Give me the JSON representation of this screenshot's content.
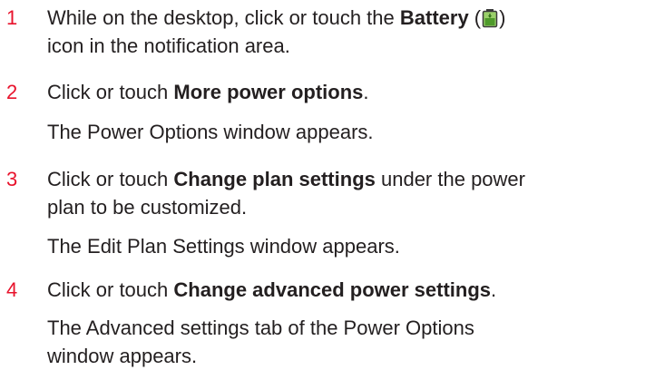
{
  "steps": [
    {
      "number": "1",
      "line1_pre": "While on the desktop, click or touch the ",
      "line1_bold": "Battery",
      "line1_paren_open": " (",
      "icon": "battery-icon",
      "line1_paren_close": ")",
      "line2": "icon in the notification area."
    },
    {
      "number": "2",
      "pre": "Click or touch ",
      "bold": "More power options",
      "post": ".",
      "result": "The Power Options window appears."
    },
    {
      "number": "3",
      "pre": "Click or touch ",
      "bold": "Change plan settings",
      "post": " under the power",
      "line2": "plan to be customized.",
      "result": "The Edit Plan Settings window appears."
    },
    {
      "number": "4",
      "pre": "Click or touch ",
      "bold": "Change advanced power settings",
      "post": ".",
      "result_line1": "The Advanced settings tab of the Power Options",
      "result_line2": "window appears."
    }
  ],
  "colors": {
    "step_number": "#e8132c",
    "text": "#231f20",
    "battery_green": "#6bb33e"
  }
}
